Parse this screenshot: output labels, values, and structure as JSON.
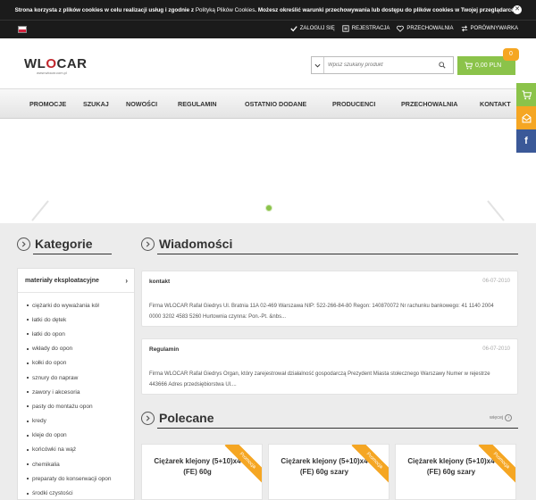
{
  "cookie": {
    "text_before": "Strona korzysta z plików cookies w celu realizacji usług i zgodnie z",
    "link": "Polityką Plików Cookies",
    "text_after": ". Możesz określić warunki przechowywania lub dostępu do plików cookies w Twojej przeglądarce.",
    "close": "✕"
  },
  "topbar": {
    "login": "ZALOGUJ SIĘ",
    "register": "REJESTRACJA",
    "wishlist": "PRZECHOWALNIA",
    "compare": "PORÓWNYWARKA"
  },
  "logo": {
    "part1": "WL",
    "part2": "O",
    "part3": "CAR",
    "subtitle": "www.wlocar.com.pl"
  },
  "search": {
    "placeholder": "Wpisz szukany produkt"
  },
  "cart": {
    "amount": "0,00 PLN",
    "count": "0"
  },
  "nav": [
    "PROMOCJE",
    "SZUKAJ",
    "NOWOŚCI",
    "REGULAMIN",
    "OSTATNIO DODANE",
    "PRODUCENCI",
    "PRZECHOWALNIA",
    "KONTAKT"
  ],
  "categories": {
    "title": "Kategorie",
    "head": "materiały eksploatacyjne",
    "items": [
      "ciężarki do wyważania kół",
      "łatki do dętek",
      "łatki do opon",
      "wkłady do opon",
      "kołki do opon",
      "sznury do napraw",
      "zawory i akcesoria",
      "pasty do montażu opon",
      "kredy",
      "kleje do opon",
      "końcówki na wąż",
      "chemikalia",
      "preparaty do konserwacji opon",
      "środki czystości"
    ]
  },
  "news": {
    "title": "Wiadomości",
    "items": [
      {
        "title": "kontakt",
        "date": "06-07-2010",
        "body": "Firma WLOCAR Rafał Giedrys Ul. Bratnia 11A 02-469 Warszawa   NIP: 522-266-84-80 Regon: 140870072 Nr rachunku bankowego: 41 1140 2004 0000 3202 4583 5260 Hurtownia czynna: Pon.-Pt.  &nbs..."
      },
      {
        "title": "Regulamin",
        "date": "06-07-2010",
        "body": "Firma WLOCAR Rafał Giedrys Organ, który zarejestrował działalność gospodarczą Prezydent Miasta stołecznego Warszawy Numer w rejestrze 443666 Adres przedsiębiorstwa Ul...."
      }
    ]
  },
  "recommended": {
    "title": "Polecane",
    "more": "więcej",
    "ribbon": "Promocja",
    "products": [
      "Ciężarek klejony (5+10)x4 (FE) 60g",
      "Ciężarek klejony (5+10)x4 (FE) 60g szary",
      "Ciężarek klejony (5+10)x4 (FE) 60g szary"
    ]
  },
  "social": {
    "facebook": "f"
  },
  "colors": {
    "accent": "#8bc34a",
    "badge": "#f5a623",
    "dark": "#1b1b1b",
    "facebook": "#3b5998"
  }
}
